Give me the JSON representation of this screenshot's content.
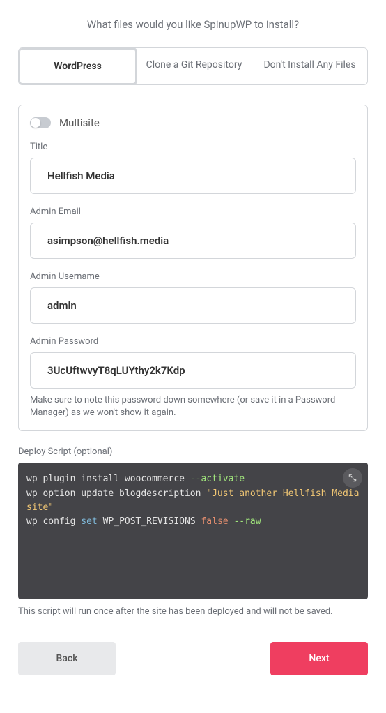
{
  "prompt": "What files would you like SpinupWP to install?",
  "tabs": [
    {
      "label": "WordPress",
      "active": true
    },
    {
      "label": "Clone a Git Repository",
      "active": false
    },
    {
      "label": "Don't Install Any Files",
      "active": false
    }
  ],
  "multisite": {
    "label": "Multisite",
    "enabled": false
  },
  "fields": {
    "title": {
      "label": "Title",
      "value": "Hellfish Media"
    },
    "email": {
      "label": "Admin Email",
      "value": "asimpson@hellfish.media"
    },
    "username": {
      "label": "Admin Username",
      "value": "admin"
    },
    "password": {
      "label": "Admin Password",
      "value": "3UcUftwvyT8qLUYthy2k7Kdp",
      "hint": "Make sure to note this password down somewhere (or save it in a Password Manager) as we won't show it again."
    }
  },
  "deploy": {
    "label": "Deploy Script (optional)",
    "lines": [
      {
        "plain": "wp plugin install woocommerce ",
        "flag": "--activate"
      },
      {
        "plain": "wp option update blogdescription ",
        "str": "\"Just another Hellfish Media site\""
      },
      {
        "plain": "wp config ",
        "kw": "set",
        "plain2": " WP_POST_REVISIONS ",
        "bool": "false",
        "flag": " --raw"
      }
    ],
    "note": "This script will run once after the site has been deployed and will not be saved."
  },
  "buttons": {
    "back": "Back",
    "next": "Next"
  }
}
